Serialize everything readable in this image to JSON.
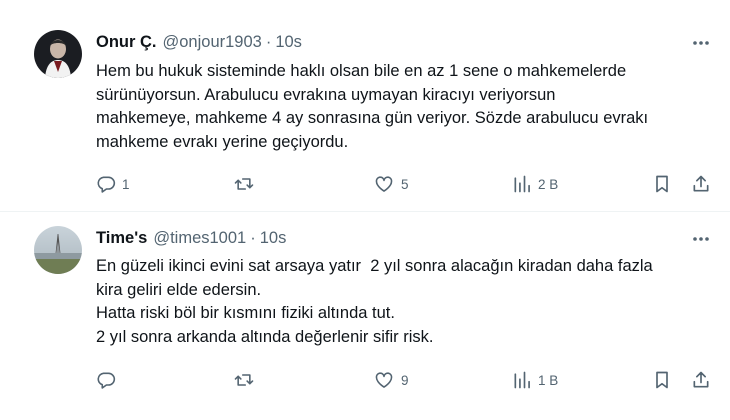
{
  "tweets": [
    {
      "name": "Onur Ç.",
      "handle": "@onjour1903",
      "separator": "·",
      "time": "10s",
      "lines": [
        "Hem bu hukuk sisteminde haklı olsan bile en az 1 sene o mahkemelerde",
        "sürünüyorsun. Arabulucu evrakına uymayan kiracıyı veriyorsun",
        "mahkemeye, mahkeme 4 ay sonrasına gün veriyor. Sözde arabulucu evrakı",
        "mahkeme evrakı yerine geçiyordu."
      ],
      "replies": "1",
      "retweets": "",
      "likes": "5",
      "views": "2 B"
    },
    {
      "name": "Time's",
      "handle": "@times1001",
      "separator": "·",
      "time": "10s",
      "lines": [
        "En güzeli ikinci evini sat arsaya yatır  2 yıl sonra alacağın kiradan daha fazla",
        "kira geliri elde edersin.",
        "Hatta riski böl bir kısmını fiziki altında tut.",
        "2 yıl sonra arkanda altında değerlenir sifir risk."
      ],
      "replies": "",
      "retweets": "",
      "likes": "9",
      "views": "1 B"
    }
  ],
  "icons": {
    "reply": "reply-icon",
    "retweet": "retweet-icon",
    "like": "heart-icon",
    "views": "views-icon",
    "bookmark": "bookmark-icon",
    "share": "share-icon",
    "more": "more-icon"
  },
  "colors": {
    "text": "#0f1419",
    "secondary": "#536471",
    "divider": "#eff3f4"
  }
}
